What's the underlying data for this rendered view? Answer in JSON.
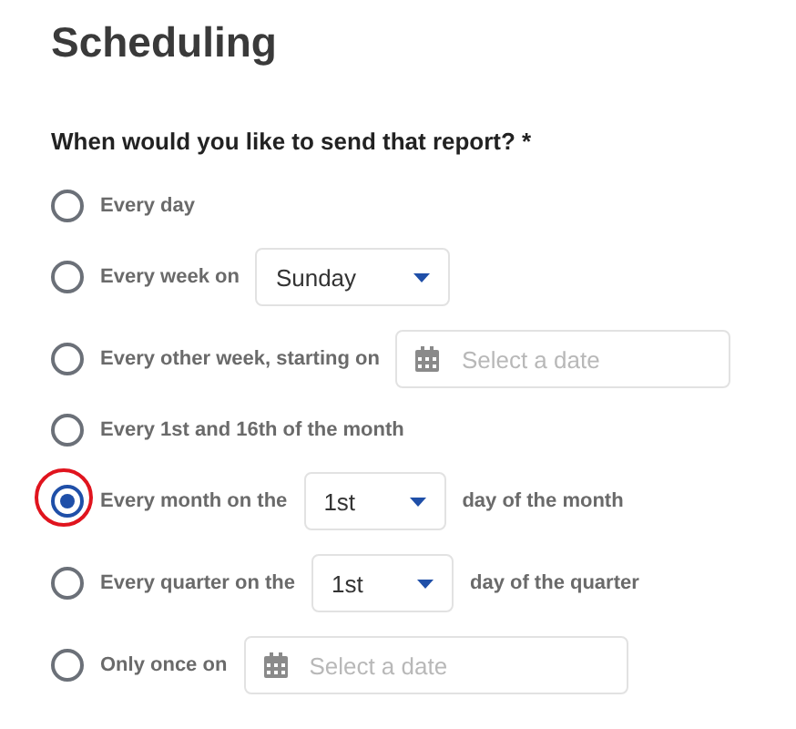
{
  "title": "Scheduling",
  "question": "When would you like to send that report? *",
  "options": [
    {
      "kind": "plain",
      "label": "Every day",
      "selected": false,
      "circled": false
    },
    {
      "kind": "select",
      "label": "Every week on",
      "value": "Sunday",
      "selected": false,
      "circled": false
    },
    {
      "kind": "date",
      "label": "Every other week, starting on",
      "placeholder": "Select a date",
      "selected": false,
      "circled": false
    },
    {
      "kind": "plain",
      "label": "Every 1st and 16th of the month",
      "selected": false,
      "circled": false
    },
    {
      "kind": "select",
      "label": "Every month on the",
      "value": "1st",
      "suffix": "day of the month",
      "selected": true,
      "circled": true
    },
    {
      "kind": "select",
      "label": "Every quarter on the",
      "value": "1st",
      "suffix": "day of the quarter",
      "selected": false,
      "circled": false
    },
    {
      "kind": "date",
      "label": "Only once on",
      "placeholder": "Select a date",
      "selected": false,
      "circled": false
    }
  ]
}
